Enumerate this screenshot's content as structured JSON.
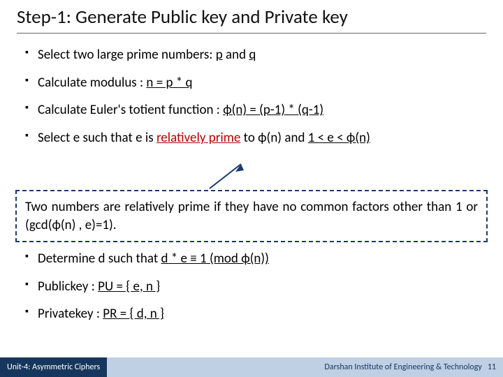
{
  "title": "Step-1: Generate Public key and Private key",
  "bullets": {
    "b1_pre": "Select two large prime numbers: ",
    "b1_p": "p",
    "b1_mid": " and ",
    "b1_q": "q",
    "b2_pre": "Calculate modulus : ",
    "b2_eq": "n = p * q",
    "b3_pre": "Calculate Euler's totient function : ",
    "b3_eq": "ϕ(n) = (p-1) * (q-1)",
    "b4_pre": "Select e such that e is ",
    "b4_rel": "relatively prime",
    "b4_mid": " to ϕ(n) and ",
    "b4_range": "1 < e < ϕ(n)"
  },
  "callout": "Two numbers are relatively prime if they have no common factors other than 1 or (gcd(ϕ(n) , e)=1).",
  "bullets2": {
    "c1_pre": "Determine d such that ",
    "c1_eq": "d * e ≡ 1 (mod ϕ(n))",
    "c2_pre": "Publickey : ",
    "c2_eq": "PU = { e, n }",
    "c3_pre": "Privatekey : ",
    "c3_eq": "PR = { d, n }"
  },
  "footer": {
    "left": "Unit-4: Asymmetric Ciphers",
    "right": "Darshan Institute of Engineering & Technology",
    "page": "11"
  }
}
